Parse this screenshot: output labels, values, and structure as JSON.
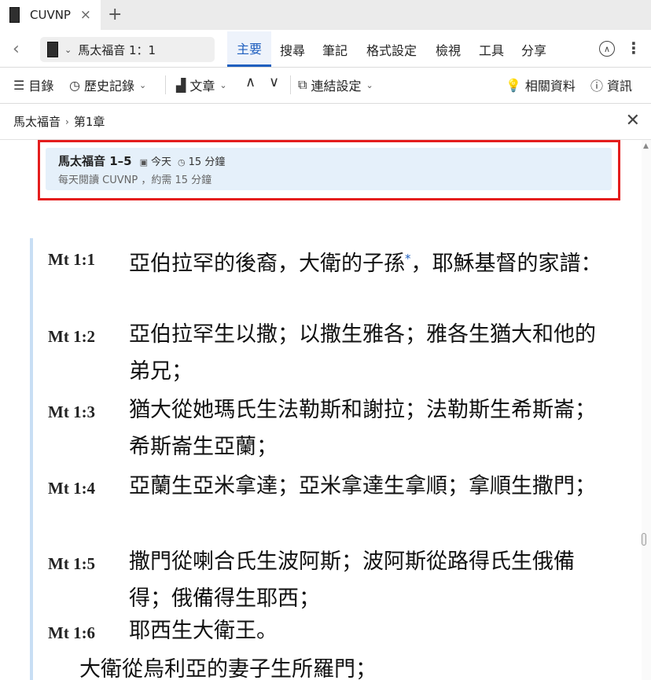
{
  "tab": {
    "title": "CUVNP",
    "close": "×",
    "new_tab": "+"
  },
  "nav": {
    "back": "‹",
    "reference": "馬太福音 1：1",
    "ribbon_tabs": [
      "主要",
      "搜尋",
      "筆記",
      "格式設定",
      "檢視",
      "工具",
      "分享"
    ],
    "active_tab_index": 0
  },
  "toolbar": {
    "contents": "目錄",
    "history": "歷史記錄",
    "text": "文章",
    "link_settings": "連結設定",
    "related": "相關資料",
    "info": "資訊"
  },
  "breadcrumb": {
    "book": "馬太福音",
    "chapter": "第1章",
    "close": "✕"
  },
  "plan": {
    "title": "馬太福音 1–5",
    "date": "今天",
    "duration": "15 分鐘",
    "subtitle": "每天閱讀 CUVNP ，約需 15 分鐘"
  },
  "verses": [
    {
      "ref": "Mt 1:1",
      "text": "亞伯拉罕的後裔，大衛的子孫",
      "footnote": "*",
      "text_after": "，耶穌基督的家譜："
    },
    {
      "ref": "Mt 1:2",
      "text": "亞伯拉罕生以撒；以撒生雅各；雅各生猶大和他的弟兄；"
    },
    {
      "ref": "Mt 1:3",
      "text": "猶大從她瑪氏生法勒斯和謝拉；法勒斯生希斯崙；希斯崙生亞蘭；"
    },
    {
      "ref": "Mt 1:4",
      "text": "亞蘭生亞米拿達；亞米拿達生拿順；拿順生撒門；"
    },
    {
      "ref": "Mt 1:5",
      "text": "撒門從喇合氏生波阿斯；波阿斯從路得氏生俄備得；俄備得生耶西；"
    },
    {
      "ref": "Mt 1:6",
      "text": "耶西生大衛王。"
    }
  ],
  "continuation": "大衛從烏利亞的妻子生所羅門；",
  "colors": {
    "accent": "#1f5fbf",
    "highlight_outline": "#e41d1d",
    "plan_bg": "#e5f0fa"
  }
}
